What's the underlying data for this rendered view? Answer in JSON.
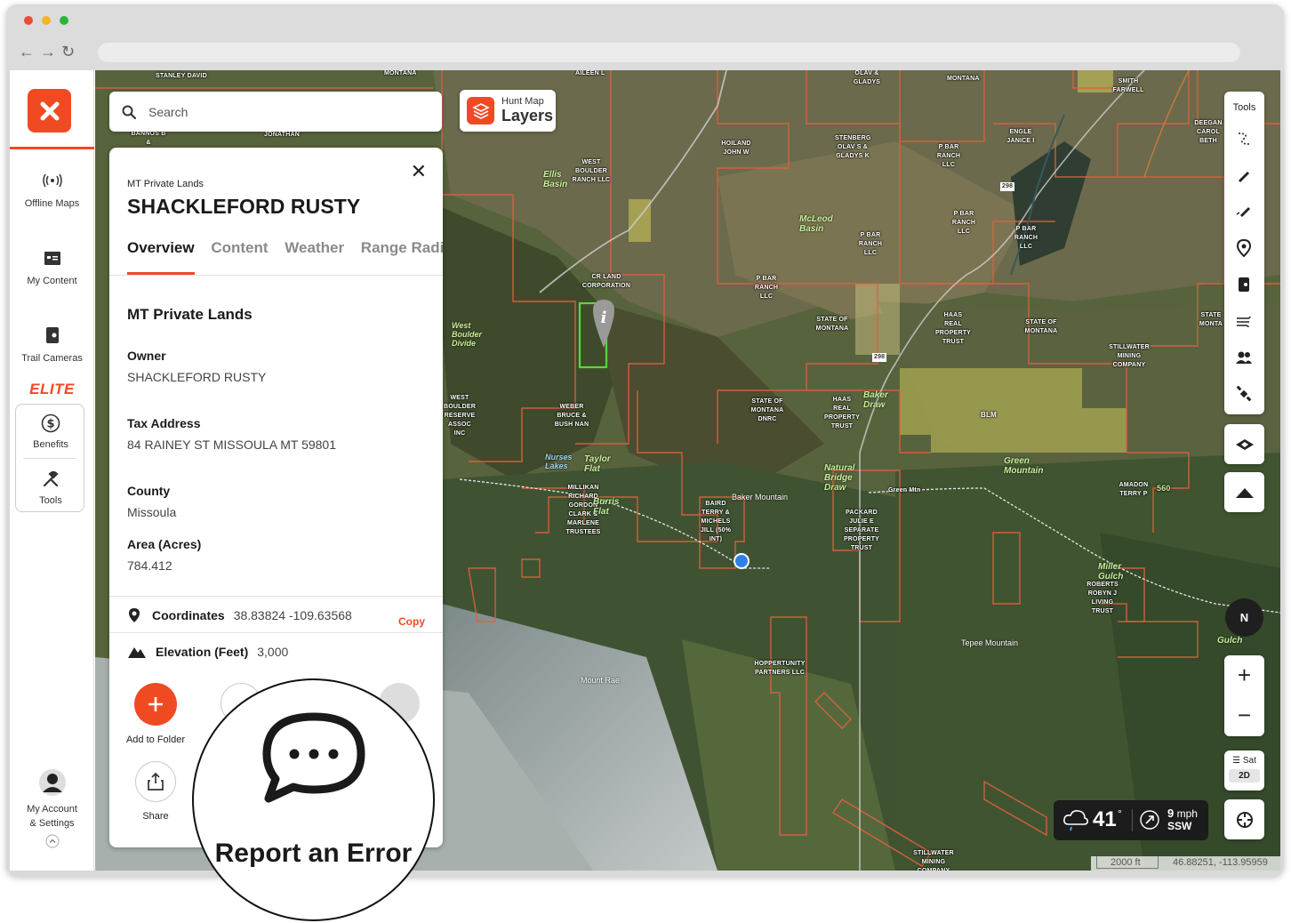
{
  "sidebar": {
    "items": [
      {
        "label": "Offline Maps",
        "icon": "offline-signal-icon"
      },
      {
        "label": "My Content",
        "icon": "folder-icon"
      },
      {
        "label": "Trail Cameras",
        "icon": "trail-camera-icon"
      }
    ],
    "elite_label": "ELITE",
    "benefits_label": "Benefits",
    "tools_label": "Tools",
    "account_label_1": "My Account",
    "account_label_2": "& Settings"
  },
  "search": {
    "placeholder": "Search"
  },
  "layers": {
    "small": "Hunt Map",
    "big": "Layers"
  },
  "panel": {
    "subtitle": "MT Private Lands",
    "title": "SHACKLEFORD RUSTY",
    "tabs": [
      "Overview",
      "Content",
      "Weather",
      "Range Radius"
    ],
    "section_title": "MT Private Lands",
    "fields": [
      {
        "label": "Owner",
        "value": "SHACKLEFORD RUSTY"
      },
      {
        "label": "Tax Address",
        "value": "84 RAINEY ST MISSOULA MT 59801"
      },
      {
        "label": "County",
        "value": "Missoula"
      },
      {
        "label": "Area (Acres)",
        "value": "784.412"
      }
    ],
    "coordinates": {
      "label": "Coordinates",
      "value": "38.83824  -109.63568",
      "copy": "Copy"
    },
    "elevation": {
      "label": "Elevation (Feet)",
      "value": "3,000"
    },
    "actions": {
      "add_folder": "Add to Folder",
      "share": "Share"
    }
  },
  "magnifier": {
    "label": "Report an Error"
  },
  "tools": {
    "label": "Tools"
  },
  "compass": "N",
  "basemap": {
    "type": "Sat",
    "mode": "2D"
  },
  "weather": {
    "temp": "41",
    "degree": "°",
    "wind_speed": "9",
    "wind_unit": "mph",
    "wind_dir": "SSW"
  },
  "scale": {
    "distance": "2000 ft",
    "coords": "46.88251, -113.95959"
  },
  "colors": {
    "brand": "#f04a23",
    "parcel_outline": "#e0603f",
    "public_land_yellow": "#c9c45a"
  },
  "map_labels": {
    "owners": [
      "STANLEY DAVID",
      "MONTANA",
      "AILEEN L",
      "OLAV & GLADYS",
      "MONTANA",
      "SMITH FARWELL",
      "DEEGAN CAROL BETH",
      "BANNOS B &",
      "JONATHAN",
      "HOILAND JOHN W",
      "STENBERG OLAV S & GLADYS K",
      "P BAR RANCH LLC",
      "ENGLE JANICE I",
      "WEST BOULDER RANCH LLC",
      "P BAR RANCH LLC",
      "P BAR RANCH LLC",
      "P BAR RANCH LLC",
      "P BAR RANCH LLC",
      "CR LAND CORPORATION",
      "STATE OF MONTANA",
      "HAAS REAL PROPERTY TRUST",
      "STATE OF MONTANA",
      "STILLWATER MINING COMPANY",
      "STATE MONTA",
      "WEST BOULDER RESERVE ASSOC INC",
      "WEBER BRUCE & BUSH NAN",
      "STATE OF MONTANA DNRC",
      "HAAS REAL PROPERTY TRUST",
      "BLM",
      "MILLIKAN RICHARD GORDON CLARK & MARLENE TRUSTEES",
      "BAIRD TERRY & MICHELS JILL (50% INT)",
      "PACKARD JULIE E SEPARATE PROPERTY TRUST",
      "AMADON TERRY P",
      "ROBERTS ROBYN J LIVING TRUST",
      "HOPPERTUNITY PARTNERS LLC",
      "STILLWATER MINING COMPANY"
    ],
    "places": [
      "Ellis Basin",
      "McLeod Basin",
      "West Boulder Divide",
      "Nurses Lakes",
      "Taylor Flat",
      "Burris Flat",
      "Baker Draw",
      "Green Mountain",
      "Natural Bridge Draw",
      "Miller Gulch",
      "Gulch"
    ],
    "mountains": [
      "Baker Mountain",
      "Tepee Mountain",
      "Mount Rae"
    ],
    "roads": [
      "298",
      "298",
      "560",
      "Green Mtn"
    ]
  }
}
